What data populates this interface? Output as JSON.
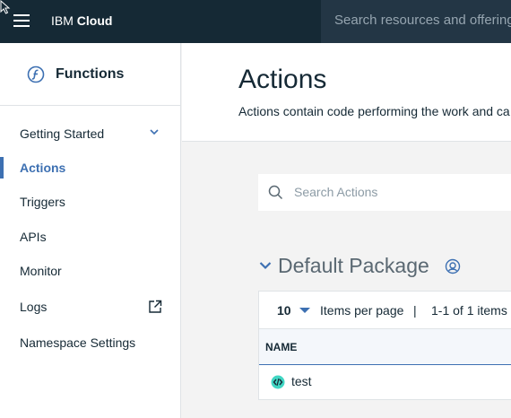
{
  "topbar": {
    "brand_ibm": "IBM",
    "brand_cloud": "Cloud",
    "search_placeholder": "Search resources and offerings..."
  },
  "sidebar": {
    "title": "Functions",
    "items": [
      {
        "label": "Getting Started",
        "icon": "chevron-down-icon"
      },
      {
        "label": "Actions",
        "active": true
      },
      {
        "label": "Triggers"
      },
      {
        "label": "APIs"
      },
      {
        "label": "Monitor"
      },
      {
        "label": "Logs",
        "icon": "external-link-icon"
      },
      {
        "label": "Namespace Settings"
      }
    ]
  },
  "main": {
    "title": "Actions",
    "description": "Actions contain code performing the work and ca",
    "search_placeholder": "Search Actions"
  },
  "package": {
    "title": "Default Package",
    "icon": "package-settings-icon"
  },
  "table": {
    "items_per_page_value": "10",
    "items_per_page_label": "Items per page",
    "separator": "|",
    "range": "1-1 of 1 items",
    "column_name": "NAME",
    "rows": [
      {
        "name": "test",
        "icon": "code-icon"
      }
    ]
  },
  "colors": {
    "topbar": "#152935",
    "accent": "#3d70b2",
    "code_icon": "#41d6c3"
  }
}
